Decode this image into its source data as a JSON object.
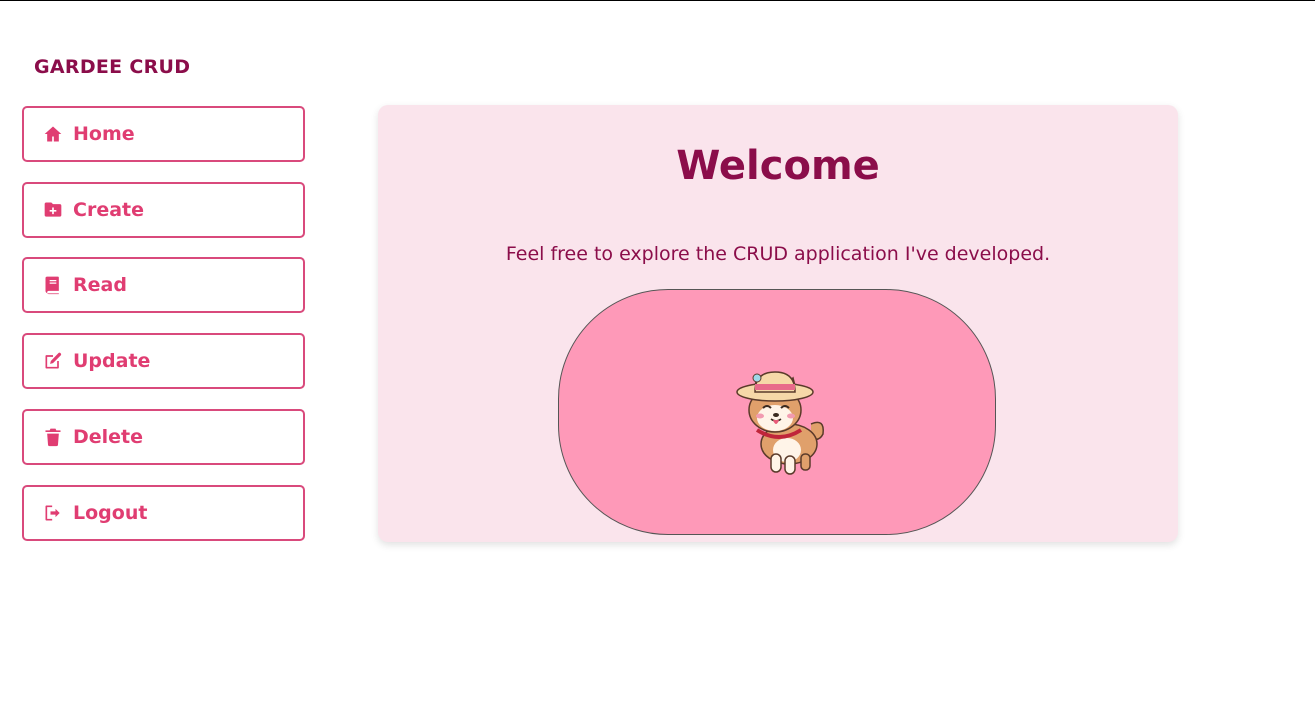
{
  "brand": "GARDEE CRUD",
  "nav": {
    "items": [
      {
        "label": "Home",
        "icon": "home-icon"
      },
      {
        "label": "Create",
        "icon": "folder-plus-icon"
      },
      {
        "label": "Read",
        "icon": "book-icon"
      },
      {
        "label": "Update",
        "icon": "edit-icon"
      },
      {
        "label": "Delete",
        "icon": "trash-icon"
      },
      {
        "label": "Logout",
        "icon": "logout-icon"
      }
    ]
  },
  "main": {
    "title": "Welcome",
    "text": "Feel free to explore the CRUD application I've developed."
  },
  "colors": {
    "accent": "#e03d72",
    "dark": "#8b0d4a",
    "card_bg": "#fae4ec",
    "pill_bg": "#fe99b8"
  }
}
